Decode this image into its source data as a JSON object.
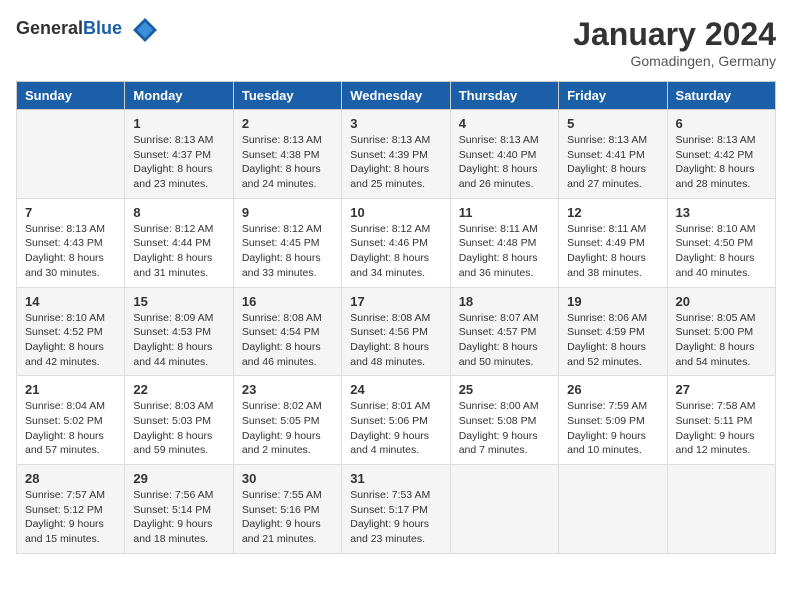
{
  "header": {
    "logo_general": "General",
    "logo_blue": "Blue",
    "month_title": "January 2024",
    "location": "Gomadingen, Germany"
  },
  "weekdays": [
    "Sunday",
    "Monday",
    "Tuesday",
    "Wednesday",
    "Thursday",
    "Friday",
    "Saturday"
  ],
  "weeks": [
    [
      {
        "day": "",
        "sunrise": "",
        "sunset": "",
        "daylight": ""
      },
      {
        "day": "1",
        "sunrise": "Sunrise: 8:13 AM",
        "sunset": "Sunset: 4:37 PM",
        "daylight": "Daylight: 8 hours and 23 minutes."
      },
      {
        "day": "2",
        "sunrise": "Sunrise: 8:13 AM",
        "sunset": "Sunset: 4:38 PM",
        "daylight": "Daylight: 8 hours and 24 minutes."
      },
      {
        "day": "3",
        "sunrise": "Sunrise: 8:13 AM",
        "sunset": "Sunset: 4:39 PM",
        "daylight": "Daylight: 8 hours and 25 minutes."
      },
      {
        "day": "4",
        "sunrise": "Sunrise: 8:13 AM",
        "sunset": "Sunset: 4:40 PM",
        "daylight": "Daylight: 8 hours and 26 minutes."
      },
      {
        "day": "5",
        "sunrise": "Sunrise: 8:13 AM",
        "sunset": "Sunset: 4:41 PM",
        "daylight": "Daylight: 8 hours and 27 minutes."
      },
      {
        "day": "6",
        "sunrise": "Sunrise: 8:13 AM",
        "sunset": "Sunset: 4:42 PM",
        "daylight": "Daylight: 8 hours and 28 minutes."
      }
    ],
    [
      {
        "day": "7",
        "sunrise": "Sunrise: 8:13 AM",
        "sunset": "Sunset: 4:43 PM",
        "daylight": "Daylight: 8 hours and 30 minutes."
      },
      {
        "day": "8",
        "sunrise": "Sunrise: 8:12 AM",
        "sunset": "Sunset: 4:44 PM",
        "daylight": "Daylight: 8 hours and 31 minutes."
      },
      {
        "day": "9",
        "sunrise": "Sunrise: 8:12 AM",
        "sunset": "Sunset: 4:45 PM",
        "daylight": "Daylight: 8 hours and 33 minutes."
      },
      {
        "day": "10",
        "sunrise": "Sunrise: 8:12 AM",
        "sunset": "Sunset: 4:46 PM",
        "daylight": "Daylight: 8 hours and 34 minutes."
      },
      {
        "day": "11",
        "sunrise": "Sunrise: 8:11 AM",
        "sunset": "Sunset: 4:48 PM",
        "daylight": "Daylight: 8 hours and 36 minutes."
      },
      {
        "day": "12",
        "sunrise": "Sunrise: 8:11 AM",
        "sunset": "Sunset: 4:49 PM",
        "daylight": "Daylight: 8 hours and 38 minutes."
      },
      {
        "day": "13",
        "sunrise": "Sunrise: 8:10 AM",
        "sunset": "Sunset: 4:50 PM",
        "daylight": "Daylight: 8 hours and 40 minutes."
      }
    ],
    [
      {
        "day": "14",
        "sunrise": "Sunrise: 8:10 AM",
        "sunset": "Sunset: 4:52 PM",
        "daylight": "Daylight: 8 hours and 42 minutes."
      },
      {
        "day": "15",
        "sunrise": "Sunrise: 8:09 AM",
        "sunset": "Sunset: 4:53 PM",
        "daylight": "Daylight: 8 hours and 44 minutes."
      },
      {
        "day": "16",
        "sunrise": "Sunrise: 8:08 AM",
        "sunset": "Sunset: 4:54 PM",
        "daylight": "Daylight: 8 hours and 46 minutes."
      },
      {
        "day": "17",
        "sunrise": "Sunrise: 8:08 AM",
        "sunset": "Sunset: 4:56 PM",
        "daylight": "Daylight: 8 hours and 48 minutes."
      },
      {
        "day": "18",
        "sunrise": "Sunrise: 8:07 AM",
        "sunset": "Sunset: 4:57 PM",
        "daylight": "Daylight: 8 hours and 50 minutes."
      },
      {
        "day": "19",
        "sunrise": "Sunrise: 8:06 AM",
        "sunset": "Sunset: 4:59 PM",
        "daylight": "Daylight: 8 hours and 52 minutes."
      },
      {
        "day": "20",
        "sunrise": "Sunrise: 8:05 AM",
        "sunset": "Sunset: 5:00 PM",
        "daylight": "Daylight: 8 hours and 54 minutes."
      }
    ],
    [
      {
        "day": "21",
        "sunrise": "Sunrise: 8:04 AM",
        "sunset": "Sunset: 5:02 PM",
        "daylight": "Daylight: 8 hours and 57 minutes."
      },
      {
        "day": "22",
        "sunrise": "Sunrise: 8:03 AM",
        "sunset": "Sunset: 5:03 PM",
        "daylight": "Daylight: 8 hours and 59 minutes."
      },
      {
        "day": "23",
        "sunrise": "Sunrise: 8:02 AM",
        "sunset": "Sunset: 5:05 PM",
        "daylight": "Daylight: 9 hours and 2 minutes."
      },
      {
        "day": "24",
        "sunrise": "Sunrise: 8:01 AM",
        "sunset": "Sunset: 5:06 PM",
        "daylight": "Daylight: 9 hours and 4 minutes."
      },
      {
        "day": "25",
        "sunrise": "Sunrise: 8:00 AM",
        "sunset": "Sunset: 5:08 PM",
        "daylight": "Daylight: 9 hours and 7 minutes."
      },
      {
        "day": "26",
        "sunrise": "Sunrise: 7:59 AM",
        "sunset": "Sunset: 5:09 PM",
        "daylight": "Daylight: 9 hours and 10 minutes."
      },
      {
        "day": "27",
        "sunrise": "Sunrise: 7:58 AM",
        "sunset": "Sunset: 5:11 PM",
        "daylight": "Daylight: 9 hours and 12 minutes."
      }
    ],
    [
      {
        "day": "28",
        "sunrise": "Sunrise: 7:57 AM",
        "sunset": "Sunset: 5:12 PM",
        "daylight": "Daylight: 9 hours and 15 minutes."
      },
      {
        "day": "29",
        "sunrise": "Sunrise: 7:56 AM",
        "sunset": "Sunset: 5:14 PM",
        "daylight": "Daylight: 9 hours and 18 minutes."
      },
      {
        "day": "30",
        "sunrise": "Sunrise: 7:55 AM",
        "sunset": "Sunset: 5:16 PM",
        "daylight": "Daylight: 9 hours and 21 minutes."
      },
      {
        "day": "31",
        "sunrise": "Sunrise: 7:53 AM",
        "sunset": "Sunset: 5:17 PM",
        "daylight": "Daylight: 9 hours and 23 minutes."
      },
      {
        "day": "",
        "sunrise": "",
        "sunset": "",
        "daylight": ""
      },
      {
        "day": "",
        "sunrise": "",
        "sunset": "",
        "daylight": ""
      },
      {
        "day": "",
        "sunrise": "",
        "sunset": "",
        "daylight": ""
      }
    ]
  ]
}
